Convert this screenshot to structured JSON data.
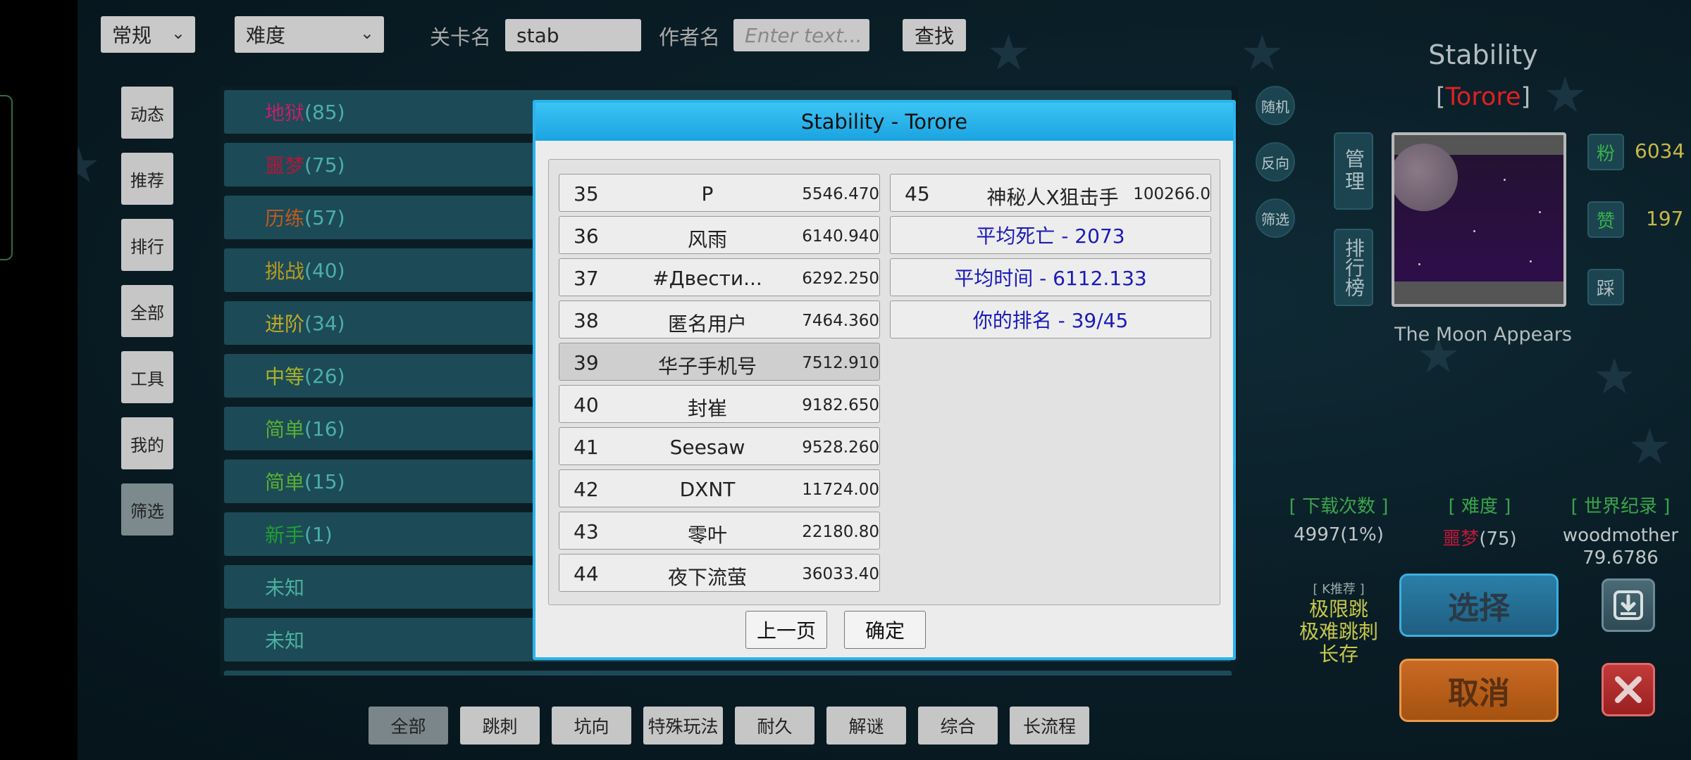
{
  "topbar": {
    "mode_select": "常规",
    "difficulty_select": "难度",
    "level_name_label": "关卡名",
    "level_name_value": "stab",
    "author_label": "作者名",
    "author_placeholder": "Enter text...",
    "search_label": "查找"
  },
  "left_nav": [
    "动态",
    "推荐",
    "排行",
    "全部",
    "工具",
    "我的",
    "筛选"
  ],
  "level_list": [
    {
      "label": "地狱",
      "count": "(85)",
      "color": "#c0206a"
    },
    {
      "label": "噩梦",
      "count": "(75)",
      "color": "#b0183a"
    },
    {
      "label": "历练",
      "count": "(57)",
      "color": "#c05a20"
    },
    {
      "label": "挑战",
      "count": "(40)",
      "color": "#b89a20"
    },
    {
      "label": "进阶",
      "count": "(34)",
      "color": "#c0a828"
    },
    {
      "label": "中等",
      "count": "(26)",
      "color": "#a8b428"
    },
    {
      "label": "简单",
      "count": "(16)",
      "color": "#58b030"
    },
    {
      "label": "简单",
      "count": "(15)",
      "color": "#58b030"
    },
    {
      "label": "新手",
      "count": "(1)",
      "color": "#20a030"
    },
    {
      "label": "未知",
      "count": "",
      "color": "#4ab0a0"
    },
    {
      "label": "未知",
      "count": "",
      "color": "#4ab0a0"
    }
  ],
  "side_round_buttons": [
    "随机",
    "反向",
    "筛选"
  ],
  "dialog": {
    "title": "Stability - Torore",
    "left_ranks": [
      {
        "rank": "35",
        "name": "P",
        "score": "5546.470"
      },
      {
        "rank": "36",
        "name": "风雨",
        "score": "6140.940"
      },
      {
        "rank": "37",
        "name": "#Двести...",
        "score": "6292.250"
      },
      {
        "rank": "38",
        "name": "匿名用户",
        "score": "7464.360"
      },
      {
        "rank": "39",
        "name": "华子手机号",
        "score": "7512.910"
      },
      {
        "rank": "40",
        "name": "封崔",
        "score": "9182.650"
      },
      {
        "rank": "41",
        "name": "Seesaw",
        "score": "9528.260"
      },
      {
        "rank": "42",
        "name": "DXNT",
        "score": "11724.00"
      },
      {
        "rank": "43",
        "name": "零叶",
        "score": "22180.80"
      },
      {
        "rank": "44",
        "name": "夜下流萤",
        "score": "36033.40"
      }
    ],
    "right_rank": {
      "rank": "45",
      "name": "神秘人X狙击手",
      "score": "100266.0"
    },
    "stats": [
      "平均死亡 - 2073",
      "平均时间 - 6112.133",
      "你的排名 - 39/45"
    ],
    "prev_button": "上一页",
    "ok_button": "确定"
  },
  "categories": [
    "全部",
    "跳刺",
    "坑向",
    "特殊玩法",
    "耐久",
    "解谜",
    "综合",
    "长流程"
  ],
  "info": {
    "level_title": "Stability",
    "author": "Torore",
    "manage_label": "管理",
    "leaderboard_label": "排行榜",
    "fans_label": "粉",
    "fans_value": "6034",
    "like_label": "赞",
    "like_value": "197",
    "dislike_label": "踩",
    "thumb_caption": "The Moon Appears",
    "downloads_header": "[ 下载次数 ]",
    "difficulty_header": "[ 难度 ]",
    "record_header": "[ 世界纪录 ]",
    "downloads_value": "4997(1%)",
    "difficulty_name": "噩梦",
    "difficulty_count": "(75)",
    "record_holder": "woodmother",
    "record_time": "79.6786",
    "k_header": "[ K推荐 ]",
    "k_tags": [
      "极限跳",
      "极难跳刺",
      "长存"
    ],
    "select_button": "选择",
    "cancel_button": "取消"
  }
}
